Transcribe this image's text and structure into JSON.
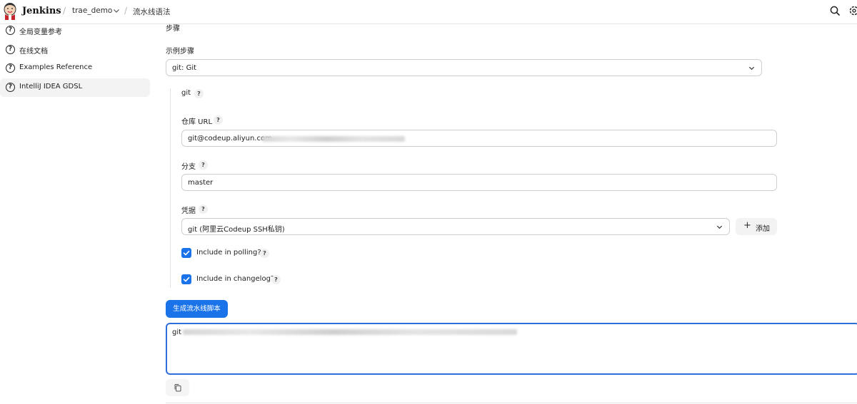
{
  "header": {
    "brand": "Jenkins",
    "crumbs": [
      "trae_demo",
      "流水线语法"
    ],
    "icons": [
      "search-icon",
      "settings-icon"
    ]
  },
  "sidebar": {
    "items": [
      {
        "label": "全局变量参考",
        "icon": "help-circle-icon",
        "active": false
      },
      {
        "label": "在线文档",
        "icon": "help-circle-icon",
        "active": false
      },
      {
        "label": "Examples Reference",
        "icon": "help-circle-icon",
        "active": false
      },
      {
        "label": "IntelliJ IDEA GDSL",
        "icon": "help-circle-icon",
        "active": true
      }
    ]
  },
  "main": {
    "section_title": "步骤",
    "sample_step_label": "示例步骤",
    "sample_step_value": "git: Git",
    "step_name": "git",
    "help_glyph": "?",
    "repo_url": {
      "label": "仓库 URL",
      "value": "git@codeup.aliyun.com"
    },
    "branch": {
      "label": "分支",
      "value": "master"
    },
    "credentials": {
      "label": "凭据",
      "value": "git (阿里云Codeup SSH私钥)",
      "add_label": "添加",
      "add_glyph": "+"
    },
    "include_polling": {
      "label": "Include in polling?",
      "checked": true
    },
    "include_changelog": {
      "label": "Include in changelog?",
      "checked": true
    },
    "generate_button": "生成流水线脚本",
    "script_output": "git"
  },
  "colors": {
    "accent": "#1a73e8",
    "focus_border": "#2f6fdc"
  }
}
